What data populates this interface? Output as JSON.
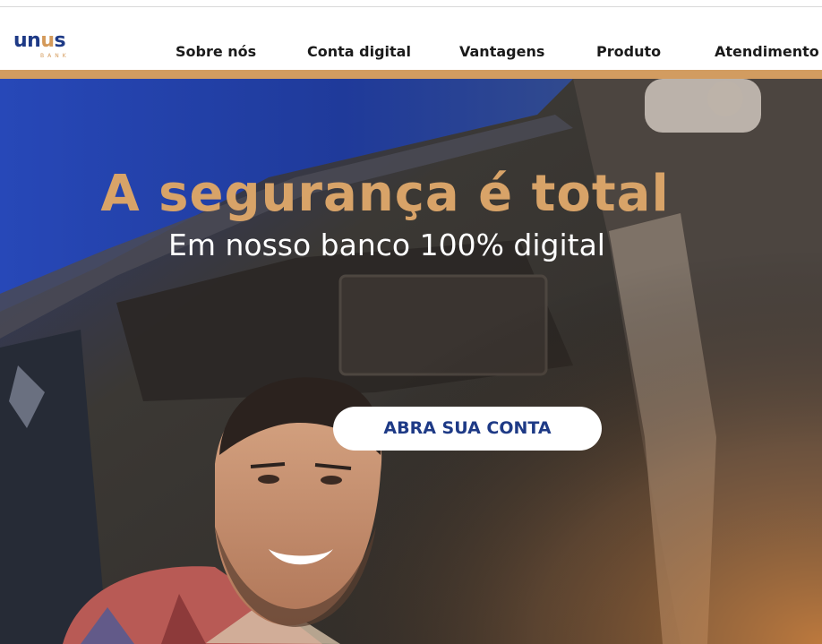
{
  "brand": {
    "name_start": "un",
    "name_accent": "u",
    "name_end": "s",
    "tagline": "BANK"
  },
  "nav": {
    "items": [
      {
        "label": "Sobre nós"
      },
      {
        "label": "Conta digital"
      },
      {
        "label": "Vantagens"
      },
      {
        "label": "Produto"
      },
      {
        "label": "Atendimento"
      }
    ]
  },
  "hero": {
    "title": "A segurança é total",
    "subtitle": "Em nosso banco 100% digital",
    "cta_label": "ABRA SUA CONTA"
  },
  "colors": {
    "brand_blue": "#1e3a86",
    "accent_gold": "#d29c60",
    "title_gold": "#d8a368"
  }
}
